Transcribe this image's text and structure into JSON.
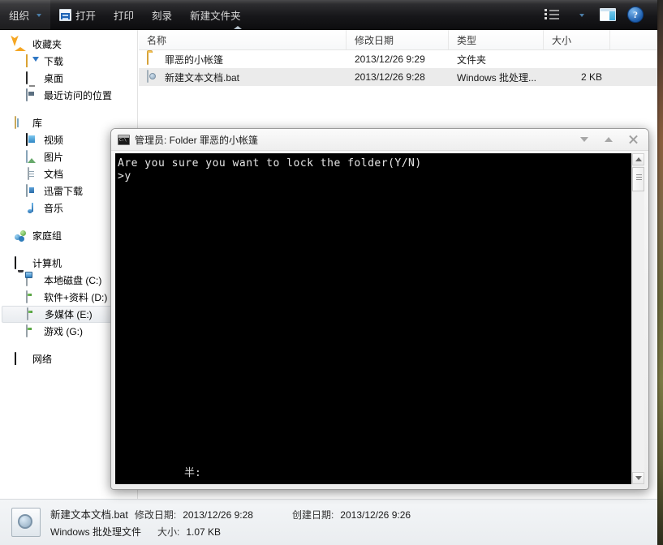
{
  "toolbar": {
    "organize_label": "组织",
    "open_label": "打开",
    "print_label": "打印",
    "burn_label": "刻录",
    "new_folder_label": "新建文件夹",
    "help_glyph": "?"
  },
  "sidebar": {
    "groups": [
      {
        "header": {
          "label": "收藏夹",
          "icon": "star-icon"
        },
        "items": [
          {
            "label": "下载",
            "icon": "download-folder-icon",
            "selected": false
          },
          {
            "label": "桌面",
            "icon": "desktop-icon",
            "selected": false
          },
          {
            "label": "最近访问的位置",
            "icon": "recent-places-icon",
            "selected": false
          }
        ]
      },
      {
        "header": {
          "label": "库",
          "icon": "library-folder-icon"
        },
        "items": [
          {
            "label": "视频",
            "icon": "video-icon",
            "selected": false
          },
          {
            "label": "图片",
            "icon": "picture-icon",
            "selected": false
          },
          {
            "label": "文档",
            "icon": "document-icon",
            "selected": false
          },
          {
            "label": "迅雷下载",
            "icon": "thunder-download-icon",
            "selected": false
          },
          {
            "label": "音乐",
            "icon": "music-icon",
            "selected": false
          }
        ]
      },
      {
        "header": {
          "label": "家庭组",
          "icon": "homegroup-icon"
        },
        "items": []
      },
      {
        "header": {
          "label": "计算机",
          "icon": "computer-icon"
        },
        "items": [
          {
            "label": "本地磁盘 (C:)",
            "icon": "system-drive-icon",
            "selected": false
          },
          {
            "label": "软件+资料 (D:)",
            "icon": "drive-icon",
            "selected": false
          },
          {
            "label": "多媒体 (E:)",
            "icon": "drive-icon",
            "selected": true
          },
          {
            "label": "游戏 (G:)",
            "icon": "drive-icon",
            "selected": false
          }
        ]
      },
      {
        "header": {
          "label": "网络",
          "icon": "network-icon"
        },
        "items": []
      }
    ]
  },
  "filelist": {
    "columns": [
      {
        "key": "name",
        "label": "名称"
      },
      {
        "key": "date",
        "label": "修改日期"
      },
      {
        "key": "type",
        "label": "类型"
      },
      {
        "key": "size",
        "label": "大小"
      }
    ],
    "rows": [
      {
        "icon": "folder-icon",
        "name": "罪恶的小帐篷",
        "date": "2013/12/26 9:29",
        "type": "文件夹",
        "size": "",
        "selected": false
      },
      {
        "icon": "bat-file-icon",
        "name": "新建文本文档.bat",
        "date": "2013/12/26 9:28",
        "type": "Windows 批处理...",
        "size": "2 KB",
        "selected": true
      }
    ]
  },
  "console": {
    "title": "管理员: Folder 罪恶的小帐篷",
    "output": "Are you sure you want to lock the folder(Y/N)\n>y",
    "bottom_text": "半:",
    "buttons": {
      "minimize": "minimize",
      "maximize": "maximize",
      "close": "close"
    }
  },
  "statusbar": {
    "file_name": "新建文本文档.bat",
    "modified_label": "修改日期:",
    "modified_value": "2013/12/26 9:28",
    "created_label": "创建日期:",
    "created_value": "2013/12/26 9:26",
    "file_type": "Windows 批处理文件",
    "size_label": "大小:",
    "size_value": "1.07 KB"
  }
}
